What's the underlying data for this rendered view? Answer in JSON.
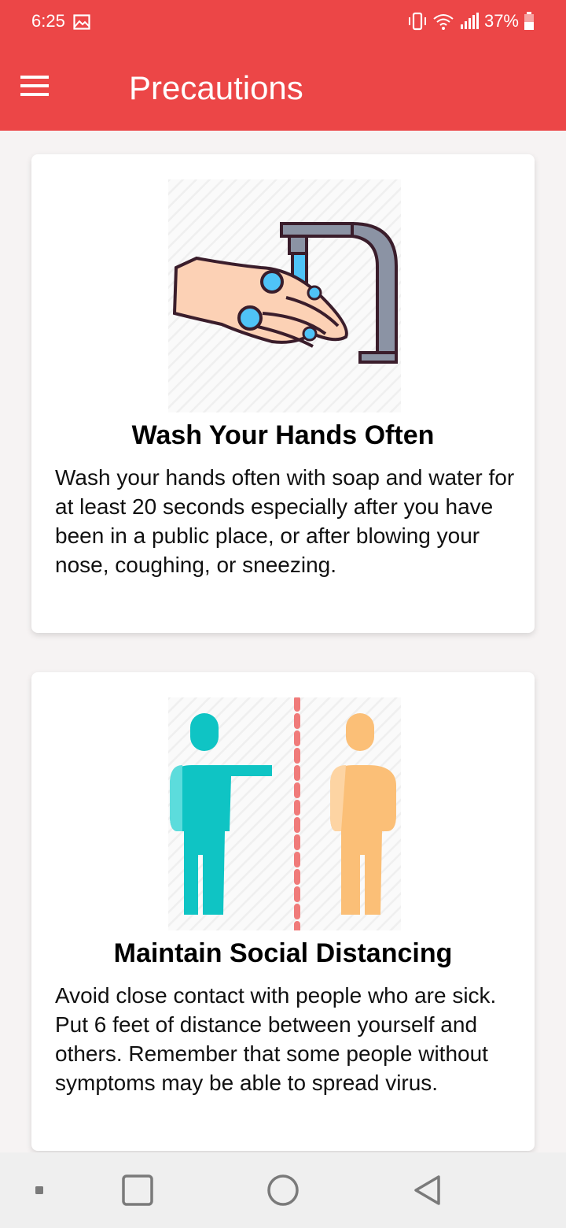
{
  "status_bar": {
    "time": "6:25",
    "battery": "37%"
  },
  "app_bar": {
    "title": "Precautions"
  },
  "cards": [
    {
      "title": "Wash Your Hands Often",
      "body": "Wash your hands often with soap and water for at least 20 seconds especially after you have been in a public place, or after blowing your nose, coughing, or sneezing.",
      "icon": "handwashing-illustration"
    },
    {
      "title": "Maintain Social Distancing",
      "body": "Avoid close contact with people who are sick. Put 6 feet of distance between yourself and others. Remember that some people without symptoms may be able to spread virus.",
      "icon": "social-distancing-illustration"
    }
  ],
  "nav_bar": {
    "icons": [
      "recents-dot-icon",
      "overview-square-icon",
      "home-circle-icon",
      "back-triangle-icon"
    ]
  },
  "colors": {
    "accent": "#ec4647",
    "teal": "#0fc4c4",
    "peach": "#fbbf77"
  }
}
